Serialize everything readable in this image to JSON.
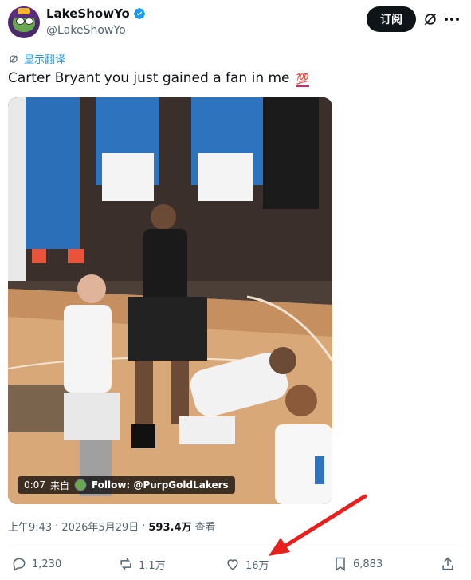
{
  "author": {
    "display_name": "LakeShowYo",
    "handle": "@LakeShowYo",
    "verified": true
  },
  "header": {
    "subscribe_label": "订阅"
  },
  "tweet": {
    "translate_label": "显示翻译",
    "text": "Carter Bryant you just gained a fan in me",
    "emoji": "💯"
  },
  "media": {
    "duration": "0:07",
    "source_prefix": "来自",
    "source_label": "Follow: @PurpGoldLakers"
  },
  "meta": {
    "time": "上午9:43",
    "separator": "·",
    "date": "2026年5月29日",
    "views_count": "593.4万",
    "views_label": "查看"
  },
  "actions": {
    "replies": "1,230",
    "reposts": "1.1万",
    "likes": "16万",
    "bookmarks": "6,883"
  },
  "colors": {
    "accent": "#1d9bf0",
    "text": "#0f1419",
    "muted": "#536471",
    "annotation_arrow": "#e8201d"
  }
}
